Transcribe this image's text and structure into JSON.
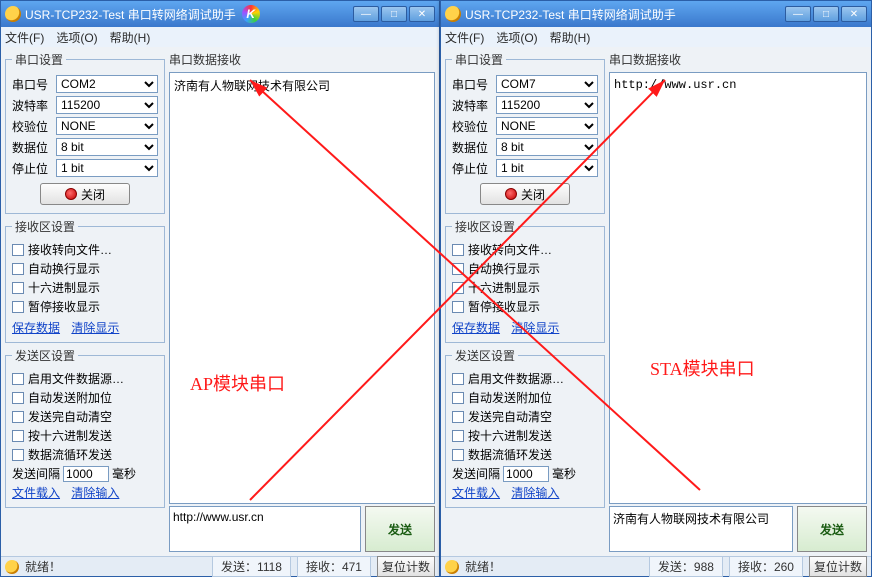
{
  "windows": [
    {
      "title": "USR-TCP232-Test 串口转网络调试助手",
      "menu": {
        "file": "文件(F)",
        "options": "选项(O)",
        "help": "帮助(H)"
      },
      "serial": {
        "legend": "串口设置",
        "port_lbl": "串口号",
        "port": "COM2",
        "baud_lbl": "波特率",
        "baud": "115200",
        "parity_lbl": "校验位",
        "parity": "NONE",
        "data_lbl": "数据位",
        "data": "8 bit",
        "stop_lbl": "停止位",
        "stop": "1 bit",
        "toggle": "关闭"
      },
      "recvopts": {
        "legend": "接收区设置",
        "c1": "接收转向文件…",
        "c2": "自动换行显示",
        "c3": "十六进制显示",
        "c4": "暂停接收显示",
        "save": "保存数据",
        "clear": "清除显示"
      },
      "sendopts": {
        "legend": "发送区设置",
        "c1": "启用文件数据源…",
        "c2": "自动发送附加位",
        "c3": "发送完自动清空",
        "c4": "按十六进制发送",
        "c5": "数据流循环发送",
        "interval_lbl": "发送间隔",
        "interval": "1000",
        "interval_unit": "毫秒",
        "load": "文件载入",
        "clearin": "清除输入"
      },
      "recv_label": "串口数据接收",
      "recv_text": "济南有人物联网技术有限公司",
      "send_text": "http://www.usr.cn",
      "send_btn": "发送",
      "status": {
        "ready": "就绪！",
        "tx": "发送：1118",
        "rx": "接收：471",
        "reset": "复位计数"
      },
      "extra_logo": true
    },
    {
      "title": "USR-TCP232-Test 串口转网络调试助手",
      "menu": {
        "file": "文件(F)",
        "options": "选项(O)",
        "help": "帮助(H)"
      },
      "serial": {
        "legend": "串口设置",
        "port_lbl": "串口号",
        "port": "COM7",
        "baud_lbl": "波特率",
        "baud": "115200",
        "parity_lbl": "校验位",
        "parity": "NONE",
        "data_lbl": "数据位",
        "data": "8 bit",
        "stop_lbl": "停止位",
        "stop": "1 bit",
        "toggle": "关闭"
      },
      "recvopts": {
        "legend": "接收区设置",
        "c1": "接收转向文件…",
        "c2": "自动换行显示",
        "c3": "十六进制显示",
        "c4": "暂停接收显示",
        "save": "保存数据",
        "clear": "清除显示"
      },
      "sendopts": {
        "legend": "发送区设置",
        "c1": "启用文件数据源…",
        "c2": "自动发送附加位",
        "c3": "发送完自动清空",
        "c4": "按十六进制发送",
        "c5": "数据流循环发送",
        "interval_lbl": "发送间隔",
        "interval": "1000",
        "interval_unit": "毫秒",
        "load": "文件载入",
        "clearin": "清除输入"
      },
      "recv_label": "串口数据接收",
      "recv_text": "http://www.usr.cn",
      "send_text": "济南有人物联网技术有限公司",
      "send_btn": "发送",
      "status": {
        "ready": "就绪！",
        "tx": "发送：988",
        "rx": "接收：260",
        "reset": "复位计数"
      },
      "extra_logo": false
    }
  ],
  "annotations": {
    "left": "AP模块串口",
    "right": "STA模块串口"
  }
}
